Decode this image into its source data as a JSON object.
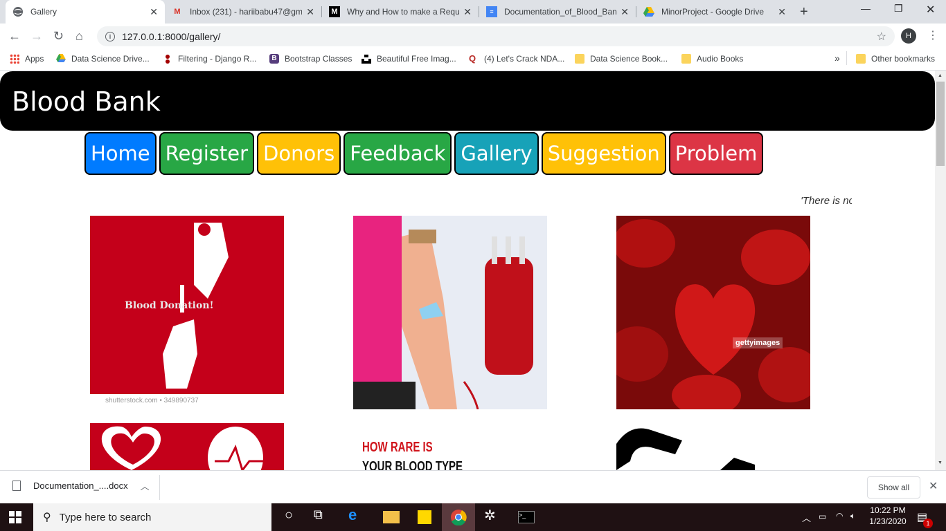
{
  "browser": {
    "tabs": [
      {
        "title": "Gallery",
        "icon": "globe-icon"
      },
      {
        "title": "Inbox (231) - hariibabu47@gm",
        "icon": "gmail-icon"
      },
      {
        "title": "Why and How to make a Requ",
        "icon": "medium-icon"
      },
      {
        "title": "Documentation_of_Blood_Bank",
        "icon": "docs-icon"
      },
      {
        "title": "MinorProject - Google Drive",
        "icon": "drive-icon"
      }
    ],
    "url": "127.0.0.1:8000/gallery/",
    "avatar_letter": "H",
    "bookmarks": [
      {
        "label": "Apps"
      },
      {
        "label": "Data Science Drive..."
      },
      {
        "label": "Filtering - Django R..."
      },
      {
        "label": "Bootstrap Classes"
      },
      {
        "label": "Beautiful Free Imag..."
      },
      {
        "label": "(4) Let's Crack NDA..."
      },
      {
        "label": "Data Science Book..."
      },
      {
        "label": "Audio Books"
      }
    ],
    "overflow": "»",
    "other_bookmarks": "Other bookmarks"
  },
  "site": {
    "title": "Blood Bank",
    "nav": [
      {
        "label": "Home",
        "color": "#007bff"
      },
      {
        "label": "Register",
        "color": "#28a745"
      },
      {
        "label": "Donors",
        "color": "#ffc107"
      },
      {
        "label": "Feedback",
        "color": "#28a745"
      },
      {
        "label": "Gallery",
        "color": "#17a2b8"
      },
      {
        "label": "Suggestion",
        "color": "#ffc107"
      },
      {
        "label": "Problem",
        "color": "#dc3545"
      }
    ],
    "marquee": "'There is no"
  },
  "gallery": {
    "img1_text": "Blood Donation!",
    "img1_watermark": "shutterstock.com • 349890737",
    "img3_watermark": "gettyimages",
    "img5_text_line1": "HOW RARE IS",
    "img5_text_line2": "YOUR BLOOD TYPE"
  },
  "downloads": {
    "file": "Documentation_....docx",
    "show_all": "Show all"
  },
  "taskbar": {
    "search_placeholder": "Type here to search",
    "time": "10:22 PM",
    "date": "1/23/2020",
    "notification_count": "1"
  }
}
